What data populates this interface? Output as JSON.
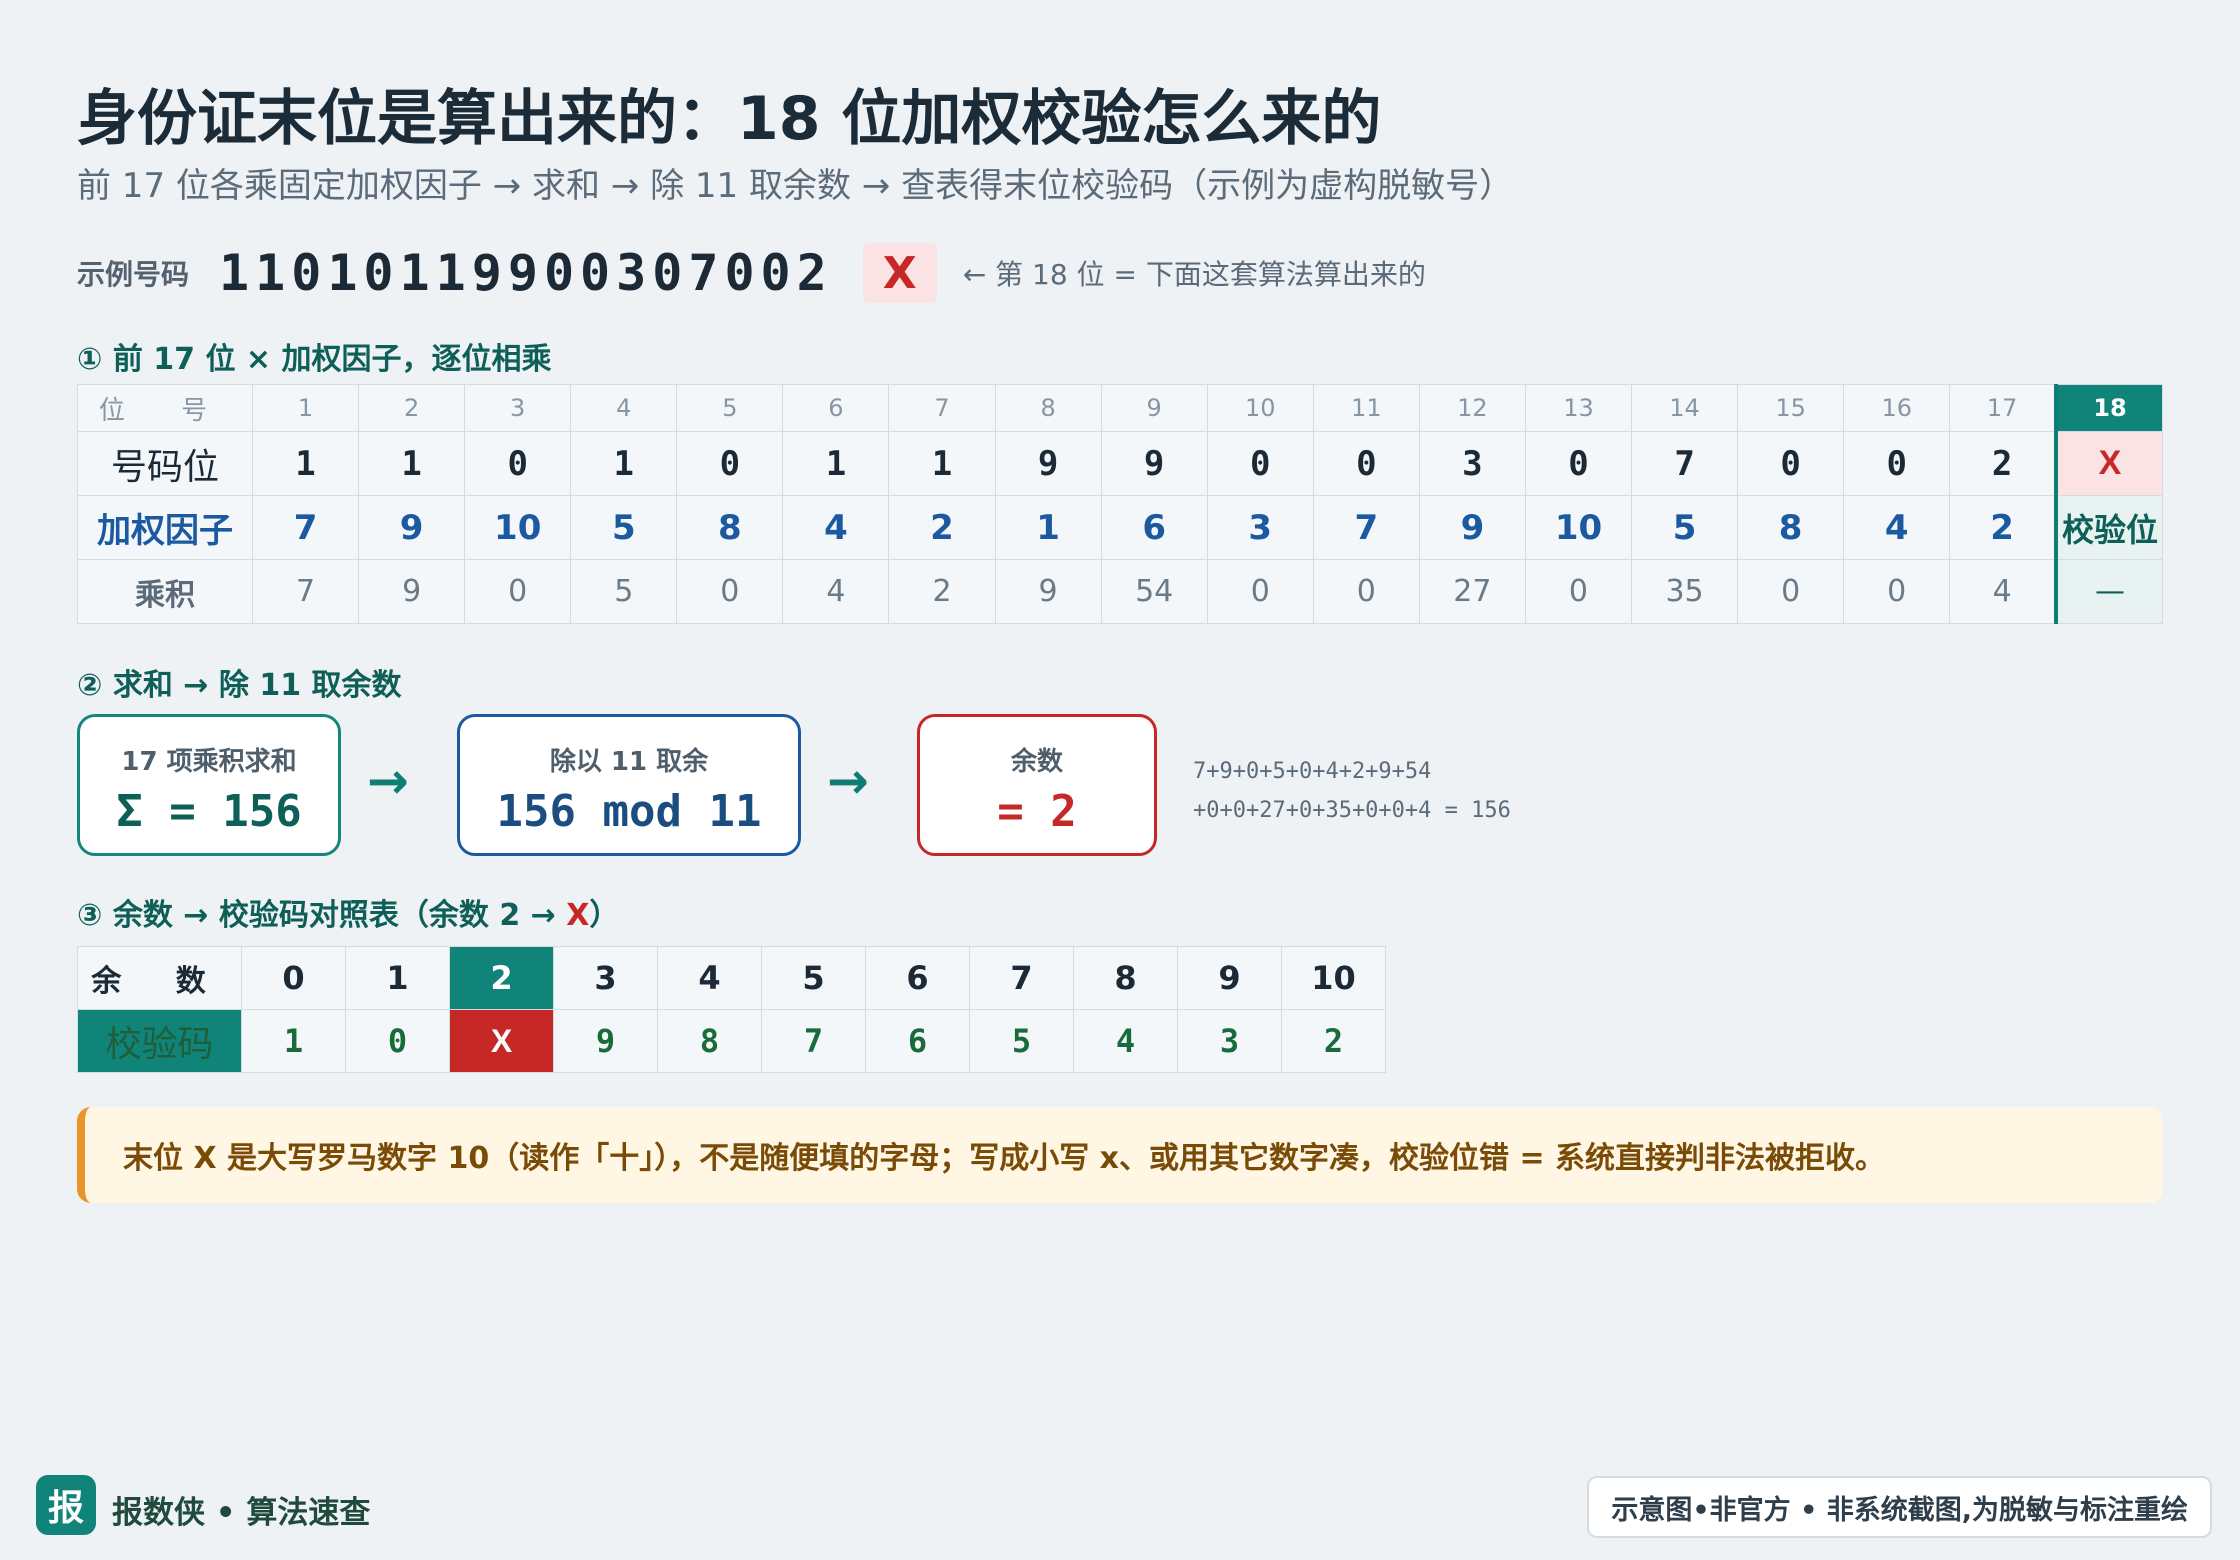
{
  "title": "身份证末位是算出来的：18 位加权校验怎么来的",
  "subtitle": "前 17 位各乘固定加权因子 → 求和 → 除 11 取余数 → 查表得末位校验码（示例为虚构脱敏号）",
  "example": {
    "label": "示例号码",
    "number": "11010119900307002",
    "check_char": "X",
    "note": "← 第 18 位 = 下面这套算法算出来的"
  },
  "step1": {
    "title": "① 前 17 位 × 加权因子，逐位相乘",
    "row_labels": [
      "位 号",
      "号码位",
      "加权因子",
      "乘积"
    ],
    "positions": [
      "1",
      "2",
      "3",
      "4",
      "5",
      "6",
      "7",
      "8",
      "9",
      "10",
      "11",
      "12",
      "13",
      "14",
      "15",
      "16",
      "17"
    ],
    "digits": [
      "1",
      "1",
      "0",
      "1",
      "0",
      "1",
      "1",
      "9",
      "9",
      "0",
      "0",
      "3",
      "0",
      "7",
      "0",
      "0",
      "2"
    ],
    "weights": [
      "7",
      "9",
      "10",
      "5",
      "8",
      "4",
      "2",
      "1",
      "6",
      "3",
      "7",
      "9",
      "10",
      "5",
      "8",
      "4",
      "2"
    ],
    "products": [
      "7",
      "9",
      "0",
      "5",
      "0",
      "4",
      "2",
      "9",
      "54",
      "0",
      "0",
      "27",
      "0",
      "35",
      "0",
      "0",
      "4"
    ],
    "last_col": {
      "position": "18",
      "digit": "X",
      "weight": "校验位",
      "product": "—"
    }
  },
  "step2": {
    "title": "② 求和 → 除 11 取余数",
    "box1": {
      "caption": "17 项乘积求和",
      "value": "Σ = 156"
    },
    "box2": {
      "caption": "除以 11 取余",
      "value": "156 mod 11"
    },
    "box3": {
      "caption": "余数",
      "value": "= 2"
    },
    "arrow": "→",
    "formula_line1": "7+9+0+5+0+4+2+9+54",
    "formula_line2": "+0+0+27+0+35+0+0+4 = 156"
  },
  "step3": {
    "title_pre": "③ 余数 → 校验码对照表（余数 2 → ",
    "title_x": "X",
    "title_post": "）",
    "row_labels": [
      "余 数",
      "校验码"
    ],
    "remainders": [
      "0",
      "1",
      "2",
      "3",
      "4",
      "5",
      "6",
      "7",
      "8",
      "9",
      "10"
    ],
    "codes": [
      "1",
      "0",
      "X",
      "9",
      "8",
      "7",
      "6",
      "5",
      "4",
      "3",
      "2"
    ],
    "highlight_index": 2
  },
  "note": "末位 X 是大写罗马数字 10（读作「十」），不是随便填的字母；写成小写 x、或用其它数字凑，校验位错 = 系统直接判非法被拒收。",
  "footer": {
    "logo": "报",
    "brand": "报数侠 • 算法速查",
    "tag": "示意图•非官方 • 非系统截图,为脱敏与标注重绘"
  },
  "colors": {
    "accent": "#11847a",
    "danger": "#c62828",
    "blue": "#1b5aa0",
    "warning": "#e8962a"
  }
}
